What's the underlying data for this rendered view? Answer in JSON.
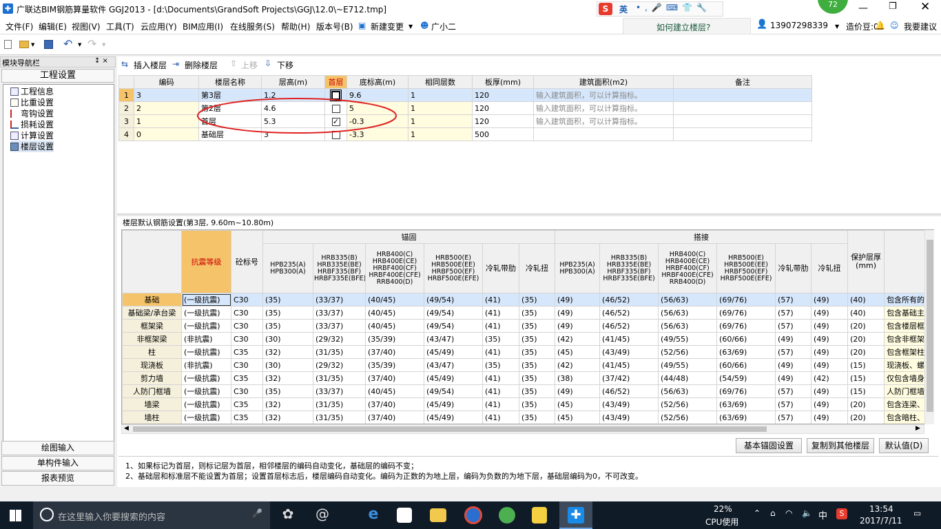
{
  "window": {
    "title": "广联达BIM钢筋算量软件 GGJ2013 - [d:\\Documents\\GrandSoft Projects\\GGJ\\12.0\\~E712.tmp]",
    "badge": "72",
    "ime_label": "英"
  },
  "menu": [
    "文件(F)",
    "编辑(E)",
    "视图(V)",
    "工具(T)",
    "云应用(Y)",
    "BIM应用(I)",
    "在线服务(S)",
    "帮助(H)",
    "版本号(B)",
    "新建变更",
    "广小二"
  ],
  "help_link": "如何建立楼层?",
  "account": {
    "phone": "13907298339",
    "coins": "造价豆:0",
    "suggest": "我要建议"
  },
  "nav": {
    "title": "模块导航栏",
    "pin": "↕ ×",
    "section": "工程设置",
    "items": [
      "工程信息",
      "比重设置",
      "弯钩设置",
      "损耗设置",
      "计算设置",
      "楼层设置"
    ],
    "bottom": [
      "绘图输入",
      "单构件输入",
      "报表预览"
    ]
  },
  "floor_toolbar": {
    "insert": "插入楼层",
    "delete": "删除楼层",
    "up": "上移",
    "down": "下移"
  },
  "floor_table": {
    "headers": [
      "编码",
      "楼层名称",
      "层高(m)",
      "首层",
      "底标高(m)",
      "相同层数",
      "板厚(mm)",
      "建筑面积(m2)",
      "备注"
    ],
    "rows": [
      {
        "n": "1",
        "code": "3",
        "name": "第3层",
        "height": "1.2",
        "first": false,
        "bottom": "9.6",
        "same": "1",
        "thick": "120",
        "area": "输入建筑面积，可以计算指标。"
      },
      {
        "n": "2",
        "code": "2",
        "name": "第2层",
        "height": "4.6",
        "first": false,
        "bottom": "5",
        "same": "1",
        "thick": "120",
        "area": "输入建筑面积，可以计算指标。"
      },
      {
        "n": "3",
        "code": "1",
        "name": "首层",
        "height": "5.3",
        "first": true,
        "bottom": "-0.3",
        "same": "1",
        "thick": "120",
        "area": "输入建筑面积，可以计算指标。"
      },
      {
        "n": "4",
        "code": "0",
        "name": "基础层",
        "height": "3",
        "first": false,
        "bottom": "-3.3",
        "same": "1",
        "thick": "500",
        "area": ""
      }
    ]
  },
  "rebar": {
    "caption": "楼层默认钢筋设置(第3层, 9.60m~10.80m)",
    "group_anchor": "锚固",
    "group_lap": "搭接",
    "col_seismic": "抗震等级",
    "col_concrete": "砼标号",
    "col_cover": "保护层厚(mm)",
    "sub_headers": [
      "HPB235(A)\nHPB300(A)",
      "HRB335(B)\nHRB335E(BE)\nHRBF335(BF)\nHRBF335E(BFE)",
      "HRB400(C)\nHRB400E(CE)\nHRBF400(CF)\nHRBF400E(CFE)\nRRB400(D)",
      "HRB500(E)\nHRB500E(EE)\nHRBF500(EF)\nHRBF500E(EFE)",
      "冷轧带肋",
      "冷轧扭"
    ],
    "rows": [
      [
        "基础",
        "(一级抗震)",
        "C30",
        "(35)",
        "(33/37)",
        "(40/45)",
        "(49/54)",
        "(41)",
        "(35)",
        "(49)",
        "(46/52)",
        "(56/63)",
        "(69/76)",
        "(57)",
        "(49)",
        "(40)",
        "包含所有的"
      ],
      [
        "基础梁/承台梁",
        "(一级抗震)",
        "C30",
        "(35)",
        "(33/37)",
        "(40/45)",
        "(49/54)",
        "(41)",
        "(35)",
        "(49)",
        "(46/52)",
        "(56/63)",
        "(69/76)",
        "(57)",
        "(49)",
        "(40)",
        "包含基础主"
      ],
      [
        "框架梁",
        "(一级抗震)",
        "C30",
        "(35)",
        "(33/37)",
        "(40/45)",
        "(49/54)",
        "(41)",
        "(35)",
        "(49)",
        "(46/52)",
        "(56/63)",
        "(69/76)",
        "(57)",
        "(49)",
        "(20)",
        "包含楼层框"
      ],
      [
        "非框架梁",
        "(非抗震)",
        "C30",
        "(30)",
        "(29/32)",
        "(35/39)",
        "(43/47)",
        "(35)",
        "(35)",
        "(42)",
        "(41/45)",
        "(49/55)",
        "(60/66)",
        "(49)",
        "(49)",
        "(20)",
        "包含非框架"
      ],
      [
        "柱",
        "(一级抗震)",
        "C35",
        "(32)",
        "(31/35)",
        "(37/40)",
        "(45/49)",
        "(41)",
        "(35)",
        "(45)",
        "(43/49)",
        "(52/56)",
        "(63/69)",
        "(57)",
        "(49)",
        "(20)",
        "包含框架柱"
      ],
      [
        "现浇板",
        "(非抗震)",
        "C30",
        "(30)",
        "(29/32)",
        "(35/39)",
        "(43/47)",
        "(35)",
        "(35)",
        "(42)",
        "(41/45)",
        "(49/55)",
        "(60/66)",
        "(49)",
        "(49)",
        "(15)",
        "现浇板、螺"
      ],
      [
        "剪力墙",
        "(一级抗震)",
        "C35",
        "(32)",
        "(31/35)",
        "(37/40)",
        "(45/49)",
        "(41)",
        "(35)",
        "(38)",
        "(37/42)",
        "(44/48)",
        "(54/59)",
        "(49)",
        "(42)",
        "(15)",
        "仅包含墙身"
      ],
      [
        "人防门框墙",
        "(一级抗震)",
        "C30",
        "(35)",
        "(33/37)",
        "(40/45)",
        "(49/54)",
        "(41)",
        "(35)",
        "(49)",
        "(46/52)",
        "(56/63)",
        "(69/76)",
        "(57)",
        "(49)",
        "(15)",
        "人防门框墙"
      ],
      [
        "墙梁",
        "(一级抗震)",
        "C35",
        "(32)",
        "(31/35)",
        "(37/40)",
        "(45/49)",
        "(41)",
        "(35)",
        "(45)",
        "(43/49)",
        "(52/56)",
        "(63/69)",
        "(57)",
        "(49)",
        "(20)",
        "包含连梁、"
      ],
      [
        "墙柱",
        "(一级抗震)",
        "C35",
        "(32)",
        "(31/35)",
        "(37/40)",
        "(45/49)",
        "(41)",
        "(35)",
        "(45)",
        "(43/49)",
        "(52/56)",
        "(63/69)",
        "(57)",
        "(49)",
        "(20)",
        "包含暗柱、"
      ]
    ]
  },
  "buttons": {
    "basic_anchor": "基本锚固设置",
    "copy": "复制到其他楼层",
    "default": "默认值(D)"
  },
  "notes": [
    "1、如果标记为首层，则标记层为首层，相邻楼层的编码自动变化，基础层的编码不变；",
    "2、基础层和标准层不能设置为首层；设置首层标志后，楼层编码自动变化。编码为正数的为地上层，编码为负数的为地下层，基础层编码为0，不可改变。"
  ],
  "taskbar": {
    "search_placeholder": "在这里输入你要搜索的内容",
    "cpu_pct": "22%",
    "cpu_label": "CPU使用",
    "ime": "中",
    "time": "13:54",
    "date": "2017/7/11"
  }
}
